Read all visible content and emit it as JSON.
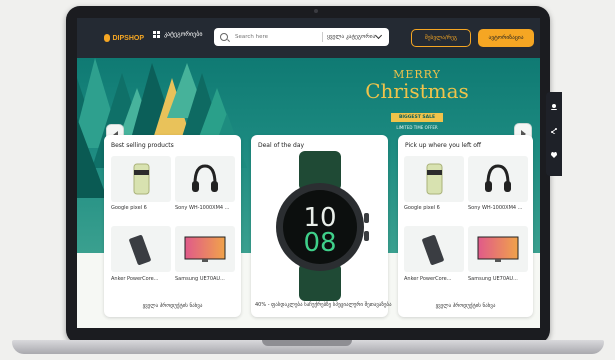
{
  "header": {
    "logo_text": "DIPSHOP",
    "categories_label": "კატეგორიები",
    "search_placeholder": "Search here",
    "search_category": "ყველა კატეგორია",
    "outline_button": "შესვლა/რეგ",
    "primary_button": "ავტორიზაცია"
  },
  "hero": {
    "merry": "MERRY",
    "title": "Christmas",
    "badge": "BIGGEST SALE",
    "sub": "LIMITED TIME OFFER"
  },
  "cards": {
    "best_selling": {
      "title": "Best selling products",
      "items": [
        {
          "label": "Google pixel 6"
        },
        {
          "label": "Sony WH-1000XM4 ..."
        },
        {
          "label": "Anker PowerCore..."
        },
        {
          "label": "Samsung UE70AU..."
        }
      ],
      "see_all": "ყველა პროდუქტის ნახვა"
    },
    "deal": {
      "title": "Deal of the day",
      "caption": "40% - ფასდაკლება საჩუქრებზე სპეციალური შეთავაზება"
    },
    "pickup": {
      "title": "Pick up where you left off",
      "items": [
        {
          "label": "Google pixel 6"
        },
        {
          "label": "Sony WH-1000XM4 ..."
        },
        {
          "label": "Anker PowerCore..."
        },
        {
          "label": "Samsung UE70AU..."
        }
      ],
      "see_all": "ყველა პროდუქტის ნახვა"
    }
  },
  "colors": {
    "accent": "#f5a623",
    "topbar": "#242a33",
    "hero": "#1c8a80",
    "gold": "#f0c34a"
  }
}
